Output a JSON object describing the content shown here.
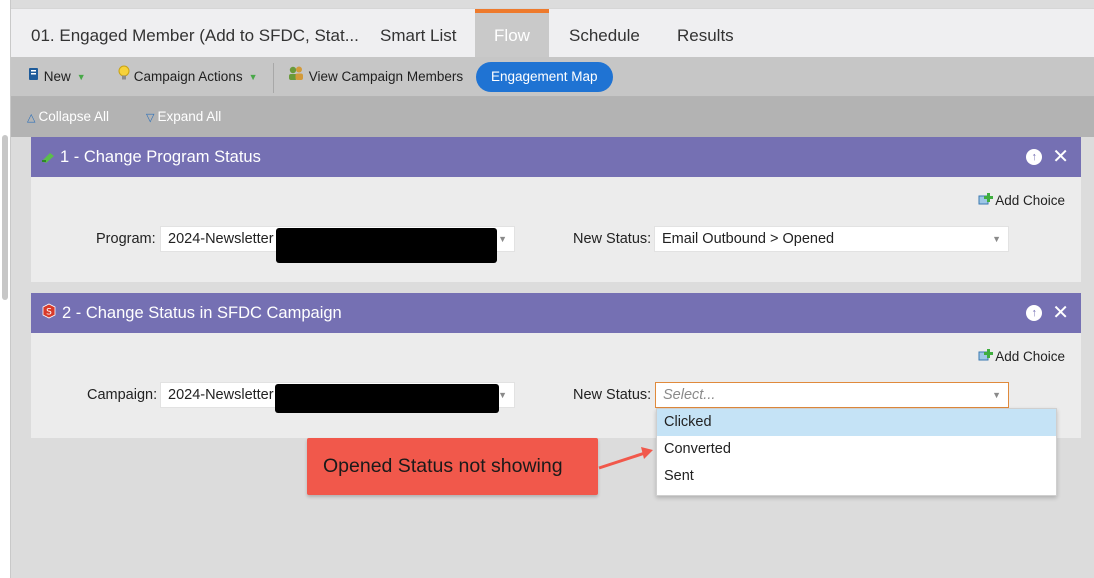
{
  "tabs": {
    "program_title": "01. Engaged Member (Add to SFDC, Stat...",
    "smart_list": "Smart List",
    "flow": "Flow",
    "schedule": "Schedule",
    "results": "Results"
  },
  "toolbar": {
    "new_label": "New",
    "campaign_actions_label": "Campaign Actions",
    "view_members_label": "View Campaign Members",
    "engagement_map_label": "Engagement Map"
  },
  "collapse_bar": {
    "collapse_all": "Collapse All",
    "expand_all": "Expand All"
  },
  "steps": [
    {
      "header": "1 - Change Program Status",
      "add_choice": "Add Choice",
      "field1_label": "Program:",
      "field1_value": "2024-Newsletter",
      "field2_label": "New Status:",
      "field2_value": "Email Outbound > Opened"
    },
    {
      "header": "2 - Change Status in SFDC Campaign",
      "add_choice": "Add Choice",
      "field1_label": "Campaign:",
      "field1_value": "2024-Newsletter",
      "field2_label": "New Status:",
      "field2_placeholder": "Select..."
    }
  ],
  "status_options": [
    "Clicked",
    "Converted",
    "Sent"
  ],
  "annotation": "Opened Status not showing",
  "colors": {
    "header_purple": "#7570b3",
    "flow_tab_accent": "#ee7a2c",
    "engagement_map_blue": "#1f73d3",
    "callout_red": "#f1584b",
    "highlight_option": "#c5e3f6"
  }
}
